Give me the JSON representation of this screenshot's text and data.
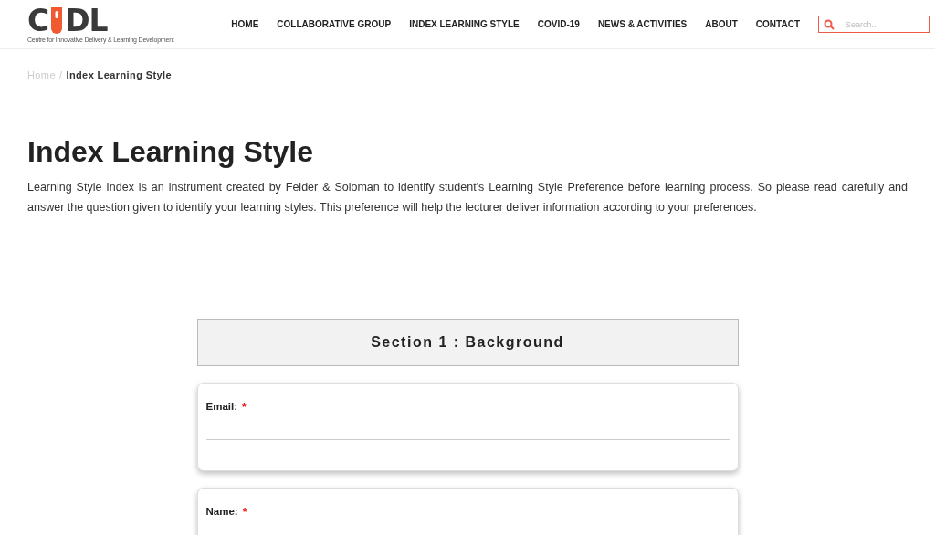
{
  "logo": {
    "lead": "C",
    "trail": "DL",
    "tagline": "Centre for Innovative Delivery & Learning Development"
  },
  "nav": [
    "HOME",
    "COLLABORATIVE GROUP",
    "INDEX LEARNING STYLE",
    "COVID-19",
    "NEWS & ACTIVITIES",
    "ABOUT",
    "CONTACT"
  ],
  "search": {
    "placeholder": "Search.."
  },
  "breadcrumb": {
    "home": "Home",
    "separator": "/",
    "current": "Index Learning Style"
  },
  "title": "Index Learning Style",
  "intro": "Learning Style Index is an instrument created by Felder & Soloman to identify student's Learning Style Preference before learning process. So please read carefully and answer the question given to identify your learning styles. This preference will help the lecturer deliver information according to your preferences.",
  "section": "Section 1 : Background",
  "fields": [
    {
      "kind": "text",
      "label": "Email:",
      "required": true,
      "required_mark": "*"
    },
    {
      "kind": "label",
      "label": "Name:",
      "required": true,
      "required_mark": "*"
    }
  ]
}
